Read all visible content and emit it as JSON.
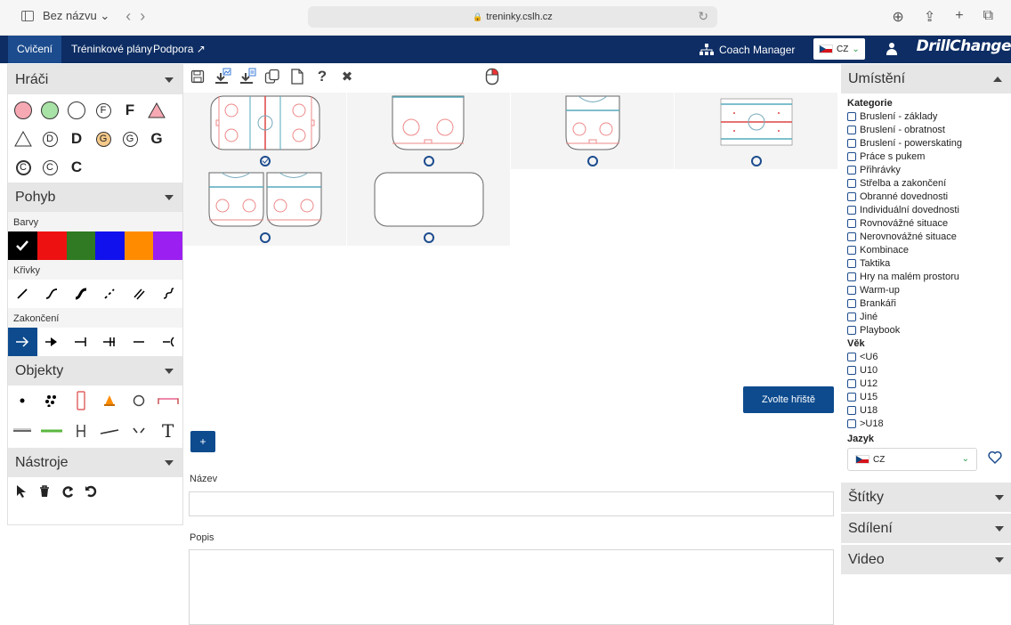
{
  "browser": {
    "tab_title": "Bez názvu",
    "tab_chev": "⌄",
    "url": "treninky.cslh.cz"
  },
  "nav": {
    "items": [
      "Cvičení",
      "Tréninkové plány",
      "Podpora"
    ],
    "coach_manager": "Coach Manager",
    "lang": "CZ",
    "logo": "DrillChange"
  },
  "left": {
    "players_title": "Hráči",
    "players_rows": [
      [
        {
          "t": "",
          "shape": "circle",
          "fill": "#f7a9b3"
        },
        {
          "t": "",
          "shape": "circle",
          "fill": "#a8e2a6"
        },
        {
          "t": "",
          "shape": "circle",
          "fill": "#fff"
        },
        {
          "t": "F",
          "shape": "circle",
          "fill": "#fff",
          "small": true
        },
        {
          "t": "F",
          "shape": "text"
        },
        {
          "t": "",
          "shape": "triangle",
          "fill": "#f7a9b3"
        }
      ],
      [
        {
          "t": "",
          "shape": "triangle",
          "fill": "#fff"
        },
        {
          "t": "D",
          "shape": "circle",
          "fill": "#fff",
          "small": true
        },
        {
          "t": "D",
          "shape": "text"
        },
        {
          "t": "G",
          "shape": "circle",
          "fill": "#f4c98a",
          "small": true
        },
        {
          "t": "G",
          "shape": "circle",
          "fill": "#fff",
          "small": true
        },
        {
          "t": "G",
          "shape": "text"
        }
      ],
      [
        {
          "t": "C",
          "shape": "circle",
          "fill": "#fff",
          "small": true,
          "thick": true
        },
        {
          "t": "C",
          "shape": "circle",
          "fill": "#fff",
          "small": true
        },
        {
          "t": "C",
          "shape": "text"
        }
      ]
    ],
    "motion_title": "Pohyb",
    "colors_label": "Barvy",
    "colors": [
      "#000000",
      "#ee1111",
      "#2f7a22",
      "#1111ee",
      "#ff8c00",
      "#9b1ff0"
    ],
    "curves_label": "Křivky",
    "endings_label": "Zakončení",
    "objects_title": "Objekty",
    "tools_title": "Nástroje",
    "text_tool": "T"
  },
  "toolbar": {
    "help": "?",
    "close": "✖"
  },
  "main": {
    "pick_rink": "Zvolte hřiště",
    "add": "+",
    "name_label": "Název",
    "desc_label": "Popis"
  },
  "right": {
    "placement_title": "Umístění",
    "category_label": "Kategorie",
    "categories": [
      "Bruslení - základy",
      "Bruslení - obratnost",
      "Bruslení - powerskating",
      "Práce s pukem",
      "Přihrávky",
      "Střelba a zakončení",
      "Obranné dovednosti",
      "Individuální dovednosti",
      "Rovnovážné situace",
      "Nerovnovážné situace",
      "Kombinace",
      "Taktika",
      "Hry na malém prostoru",
      "Warm-up",
      "Brankáři",
      "Jiné",
      "Playbook"
    ],
    "age_label": "Věk",
    "ages": [
      "<U6",
      "U10",
      "U12",
      "U15",
      "U18",
      ">U18"
    ],
    "lang_label": "Jazyk",
    "lang_value": "CZ",
    "accordions": [
      "Štítky",
      "Sdílení",
      "Video"
    ]
  },
  "colors": {
    "nav_bg": "#0d2d64",
    "accent": "#0d4b8e"
  }
}
